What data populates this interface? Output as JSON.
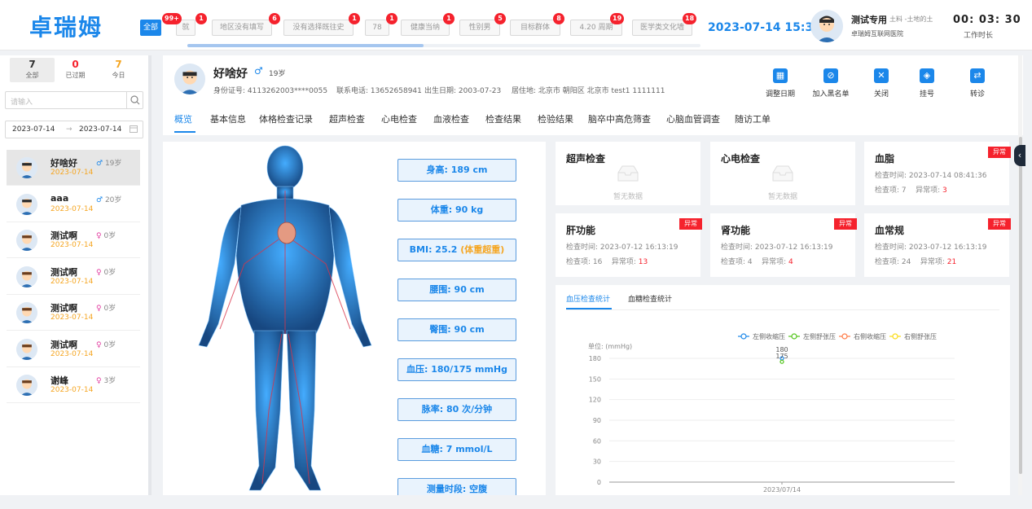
{
  "header": {
    "logo": "卓瑞姆",
    "tags": [
      {
        "label": "全部",
        "badge": "99+",
        "active": true
      },
      {
        "label": "就",
        "badge": "1"
      },
      {
        "label": "地区没有填写",
        "badge": "6"
      },
      {
        "label": "没有选择既往史",
        "badge": "1"
      },
      {
        "label": "78",
        "badge": "1"
      },
      {
        "label": "健康当纳",
        "badge": "1"
      },
      {
        "label": "性别男",
        "badge": "5"
      },
      {
        "label": "目标群体",
        "badge": "8"
      },
      {
        "label": "4.20 周期",
        "badge": "19"
      },
      {
        "label": "医学类文化墙",
        "badge": "18"
      }
    ],
    "datetime": "2023-07-14 15:31",
    "user_name": "测试专用",
    "user_role": "土料 -土地的土",
    "user_org": "卓瑞姆互联网医院",
    "work_time": "00: 03: 30",
    "work_label": "工作时长"
  },
  "stats": [
    {
      "num": "7",
      "label": "全部",
      "color": "#333333"
    },
    {
      "num": "0",
      "label": "已过期",
      "color": "#f5222d"
    },
    {
      "num": "7",
      "label": "今日",
      "color": "#f5a623"
    }
  ],
  "search": {
    "placeholder": "请输入"
  },
  "date_range": {
    "start": "2023-07-14",
    "arrow": "→",
    "end": "2023-07-14"
  },
  "patients": [
    {
      "name": "好啥好",
      "date": "2023-07-14",
      "gender": "♂",
      "age": "19岁",
      "sex": "m"
    },
    {
      "name": "aaa",
      "date": "2023-07-14",
      "gender": "♂",
      "age": "20岁",
      "sex": "m"
    },
    {
      "name": "测试啊",
      "date": "2023-07-14",
      "gender": "♀",
      "age": "0岁",
      "sex": "f"
    },
    {
      "name": "测试啊",
      "date": "2023-07-14",
      "gender": "♀",
      "age": "0岁",
      "sex": "f"
    },
    {
      "name": "测试啊",
      "date": "2023-07-14",
      "gender": "♀",
      "age": "0岁",
      "sex": "f"
    },
    {
      "name": "测试啊",
      "date": "2023-07-14",
      "gender": "♀",
      "age": "0岁",
      "sex": "f"
    },
    {
      "name": "谢峰",
      "date": "2023-07-14",
      "gender": "♀",
      "age": "3岁",
      "sex": "f"
    }
  ],
  "patient": {
    "name": "好啥好",
    "gender": "♂",
    "age": "19岁",
    "id_card": "身份证号: 4113262003****0055",
    "phone": "联系电话: 13652658941",
    "birth": "出生日期: 2003-07-23",
    "address": "居住地: 北京市 朝阳区 北京市 test1 1111111"
  },
  "actions": [
    {
      "label": "调整日期",
      "icon": "calendar-icon",
      "glyph": "▦"
    },
    {
      "label": "加入黑名单",
      "icon": "blacklist-icon",
      "glyph": "⊘"
    },
    {
      "label": "关闭",
      "icon": "close-icon",
      "glyph": "✕"
    },
    {
      "label": "挂号",
      "icon": "register-icon",
      "glyph": "◈"
    },
    {
      "label": "转诊",
      "icon": "transfer-icon",
      "glyph": "⇄"
    }
  ],
  "tabs": [
    "概览",
    "基本信息",
    "体格检查记录",
    "超声检查",
    "心电检查",
    "血液检查",
    "检查结果",
    "检验结果",
    "脑卒中高危筛查",
    "心脑血管调查",
    "随访工单"
  ],
  "vitals": [
    {
      "text": "身高: 189 cm"
    },
    {
      "text": "体重: 90 kg"
    },
    {
      "text": "BMI: 25.2 ",
      "warn": "(体重超重)"
    },
    {
      "text": "腰围: 90 cm"
    },
    {
      "text": "臀围: 90 cm"
    },
    {
      "text": "血压:  180/175 mmHg"
    },
    {
      "text": "脉率: 80 次/分钟"
    },
    {
      "text": "血糖: 7 mmol/L"
    },
    {
      "text": "测量时段: 空腹"
    }
  ],
  "cards": [
    {
      "title": "超声检查",
      "nodata": "暂无数据"
    },
    {
      "title": "心电检查",
      "nodata": "暂无数据"
    },
    {
      "title": "血脂",
      "badge": "异常",
      "time_label": "检查时间: 2023-07-14 08:41:36",
      "count_label": "检查项: 7",
      "abn_label": "异常项: ",
      "abn": "3"
    },
    {
      "title": "肝功能",
      "badge": "异常",
      "time_label": "检查时间: 2023-07-12 16:13:19",
      "count_label": "检查项: 16",
      "abn_label": "异常项: ",
      "abn": "13"
    },
    {
      "title": "肾功能",
      "badge": "异常",
      "time_label": "检查时间: 2023-07-12 16:13:19",
      "count_label": "检查项: 4",
      "abn_label": "异常项: ",
      "abn": "4"
    },
    {
      "title": "血常规",
      "badge": "异常",
      "time_label": "检查时间: 2023-07-12 16:13:19",
      "count_label": "检查项: 24",
      "abn_label": "异常项: ",
      "abn": "21"
    }
  ],
  "chart_tabs": [
    "血压检查统计",
    "血糖检查统计"
  ],
  "chart_data": {
    "type": "line",
    "ylabel": "单位: (mmHg)",
    "categories": [
      "2023/07/14"
    ],
    "ylim": [
      0,
      180
    ],
    "yticks": [
      0,
      30,
      60,
      90,
      120,
      150,
      180
    ],
    "series": [
      {
        "name": "左侧收缩压",
        "color": "#1b87ea",
        "values": [
          180
        ]
      },
      {
        "name": "左侧舒张压",
        "color": "#52c41a",
        "values": [
          175
        ]
      },
      {
        "name": "右侧收缩压",
        "color": "#ff7a45",
        "values": [
          null
        ]
      },
      {
        "name": "右侧舒张压",
        "color": "#fadb14",
        "values": [
          null
        ]
      }
    ],
    "data_labels": [
      "180",
      "175"
    ],
    "legend": "top-right",
    "grid": true
  }
}
